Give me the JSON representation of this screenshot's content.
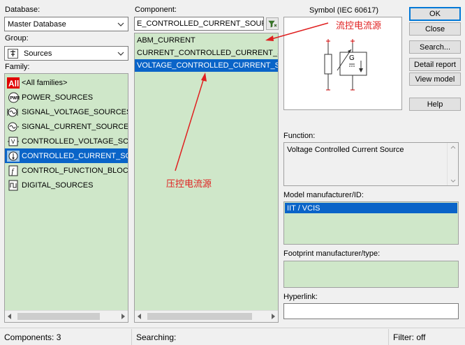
{
  "database": {
    "label": "Database:",
    "value": "Master Database"
  },
  "group": {
    "label": "Group:",
    "value": "Sources"
  },
  "family": {
    "label": "Family:",
    "items": [
      {
        "icon": "all-families-icon",
        "label": "<All families>"
      },
      {
        "icon": "power-sources-icon",
        "label": "POWER_SOURCES"
      },
      {
        "icon": "signal-voltage-icon",
        "label": "SIGNAL_VOLTAGE_SOURCES"
      },
      {
        "icon": "signal-current-icon",
        "label": "SIGNAL_CURRENT_SOURCES"
      },
      {
        "icon": "controlled-voltage-icon",
        "label": "CONTROLLED_VOLTAGE_SOUR"
      },
      {
        "icon": "controlled-current-icon",
        "label": "CONTROLLED_CURRENT_SOU"
      },
      {
        "icon": "control-function-icon",
        "label": "CONTROL_FUNCTION_BLOCKS"
      },
      {
        "icon": "digital-sources-icon",
        "label": "DIGITAL_SOURCES"
      }
    ],
    "selected_index": 5
  },
  "component": {
    "label": "Component:",
    "search_value": "E_CONTROLLED_CURRENT_SOURCE",
    "items": [
      "ABM_CURRENT",
      "CURRENT_CONTROLLED_CURRENT_SOU",
      "VOLTAGE_CONTROLLED_CURRENT_SOUR"
    ],
    "selected_index": 2
  },
  "symbol": {
    "label": "Symbol (IEC 60617)",
    "glyph": "G"
  },
  "buttons": {
    "ok": "OK",
    "close": "Close",
    "search": "Search...",
    "detail_report": "Detail report",
    "view_model": "View model",
    "help": "Help"
  },
  "function": {
    "label": "Function:",
    "value": "Voltage Controlled Current Source"
  },
  "model": {
    "label": "Model manufacturer/ID:",
    "value": "IIT / VCIS"
  },
  "footprint": {
    "label": "Footprint manufacturer/type:"
  },
  "hyperlink": {
    "label": "Hyperlink:"
  },
  "status": {
    "components": "Components: 3",
    "searching": "Searching:",
    "filter": "Filter: off"
  },
  "annotations": {
    "current_controlled": "流控电流源",
    "voltage_controlled": "压控电流源"
  },
  "colors": {
    "panel": "#cfe7c9",
    "selection": "#0a64c8",
    "annotation": "#e02020"
  }
}
